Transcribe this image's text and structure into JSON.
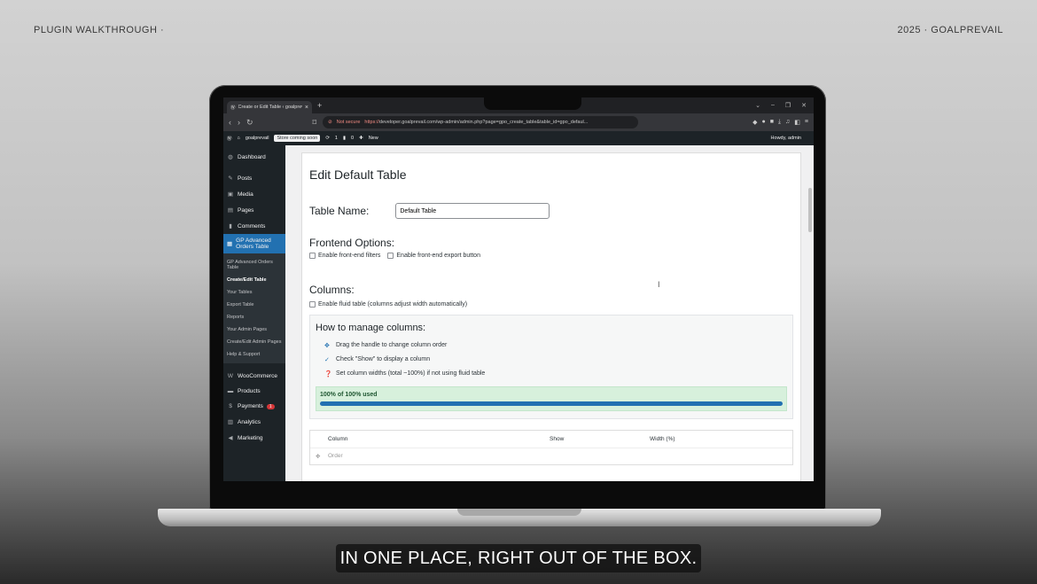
{
  "overlay": {
    "left_text": "PLUGIN WALKTHROUGH ·",
    "right_text": "2025 · GOALPREVAIL",
    "caption": "IN ONE PLACE, RIGHT OUT OF THE BOX."
  },
  "browser": {
    "tab_title": "Create or Edit Table ‹ goalprevail",
    "security_label": "Not secure",
    "url_scheme": "https://",
    "url_rest": "developer.goalprevail.com/wp-admin/admin.php?page=gpo_create_table&table_id=gpo_defaul..."
  },
  "adminbar": {
    "site": "goalprevail",
    "store": "Store coming soon",
    "updates": "1",
    "comments": "0",
    "new": "New",
    "howdy": "Howdy, admin"
  },
  "sidebar": {
    "items": [
      "Dashboard",
      "Posts",
      "Media",
      "Pages",
      "Comments"
    ],
    "current": "GP Advanced Orders Table",
    "submenu": [
      "GP Advanced Orders Table",
      "Create/Edit Table",
      "Your Tables",
      "Export Table",
      "Reports",
      "Your Admin Pages",
      "Create/Edit Admin Pages",
      "Help & Support"
    ],
    "lower": [
      "WooCommerce",
      "Products",
      "Payments",
      "Analytics",
      "Marketing"
    ],
    "payments_badge": "1"
  },
  "page": {
    "title": "Edit Default Table",
    "table_name_label": "Table Name:",
    "table_name_value": "Default Table",
    "frontend_title": "Frontend Options:",
    "filters_label": "Enable front-end filters",
    "export_label": "Enable front-end export button",
    "columns_title": "Columns:",
    "fluid_label": "Enable fluid table (columns adjust width automatically)",
    "howto_title": "How to manage columns:",
    "howto": [
      "Drag the handle to change column order",
      "Check \"Show\" to display a column",
      "Set column widths (total ~100%) if not using fluid table"
    ],
    "usage_label": "100% of 100% used",
    "usage_fraction": 1.0,
    "table_headers": [
      "Column",
      "Show",
      "Width (%)"
    ],
    "first_row": "Order"
  }
}
